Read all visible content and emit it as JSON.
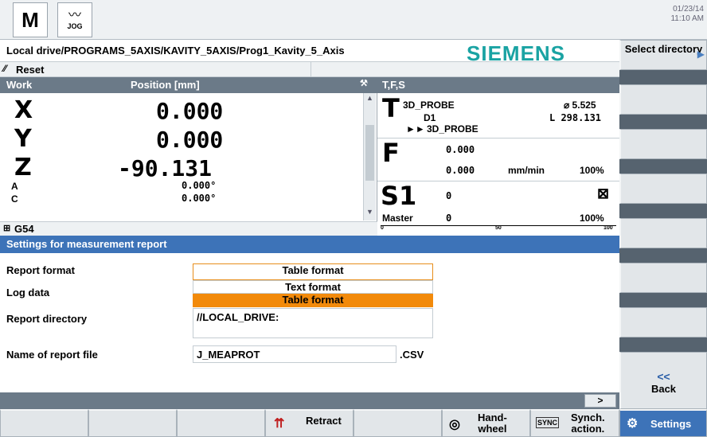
{
  "header": {
    "mode_label": "JOG",
    "date": "01/23/14",
    "time": "11:10 AM",
    "program_path": "Local drive/PROGRAMS_5AXIS/KAVITY_5AXIS/Prog1_Kavity_5_Axis",
    "brand": "SIEMENS",
    "channel_status": "Reset"
  },
  "work": {
    "header_label": "Work",
    "position_header": "Position [mm]",
    "axes": [
      {
        "name": "X",
        "value": "0.000"
      },
      {
        "name": "Y",
        "value": "0.000"
      },
      {
        "name": "Z",
        "value": "-90.131"
      },
      {
        "name": "A",
        "value": "0.000°"
      },
      {
        "name": "C",
        "value": "0.000°"
      }
    ],
    "offset": "G54"
  },
  "tfs": {
    "header_label": "T,F,S",
    "tool_letter": "T",
    "tool_name": "3D_PROBE",
    "tool_diameter": "⌀ 5.525",
    "tool_d": "D1",
    "tool_length": "L 298.131",
    "next_tool": "3D_PROBE",
    "feed_letter": "F",
    "feed_actual": "0.000",
    "feed_set": "0.000",
    "feed_unit": "mm/min",
    "feed_override": "100%",
    "spindle_letter": "S1",
    "spindle_actual": "0",
    "spindle_set": "0",
    "spindle_label": "Master",
    "spindle_override": "100%",
    "scale_0": "0",
    "scale_50": "50",
    "scale_100": "100"
  },
  "settings": {
    "title": "Settings for measurement report",
    "report_format_label": "Report format",
    "report_format_value": "Table format",
    "options": [
      "Text format",
      "Table format"
    ],
    "log_data_label": "Log data",
    "report_directory_label": "Report directory",
    "report_directory_value": "//LOCAL_DRIVE:",
    "file_name_label": "Name of report file",
    "file_name_value": "J_MEAPROT",
    "file_extension": ".CSV",
    "scroll_arrow": ">"
  },
  "vsoftkeys": {
    "select_directory": "Select directory",
    "back_arrows": "<<",
    "back": "Back"
  },
  "hsoftkeys": {
    "retract": "Retract",
    "handwheel": "Hand-\nwheel",
    "synch_action": "Synch.\naction.",
    "settings": "Settings"
  }
}
